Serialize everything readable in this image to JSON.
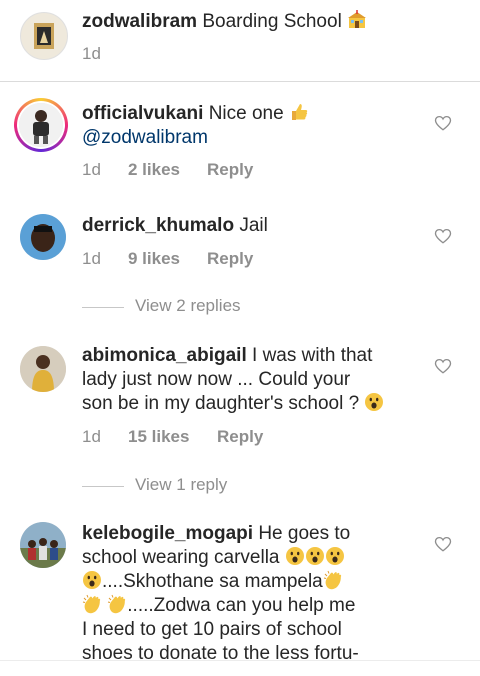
{
  "caption": {
    "username": "zodwalibram",
    "text": "Boarding School",
    "emoji": "school-emoji",
    "time": "1d"
  },
  "comments": [
    {
      "username": "officialvukani",
      "text": "Nice one",
      "emoji": "thumbs-up-emoji",
      "mention": "@zodwalibram",
      "time": "1d",
      "likes": "2 likes",
      "reply": "Reply"
    },
    {
      "username": "derrick_khumalo",
      "text": "Jail",
      "time": "1d",
      "likes": "9 likes",
      "reply": "Reply",
      "view_replies": "View 2 replies"
    },
    {
      "username": "abimonica_abigail",
      "text_line1": "I was with that",
      "text_line2": "lady just now now ... Could your",
      "text_line3": "son be in my daughter's school ?",
      "emoji": "astonished-face-emoji",
      "time": "1d",
      "likes": "15 likes",
      "reply": "Reply",
      "view_replies": "View 1 reply"
    },
    {
      "username": "kelebogile_mogapi",
      "text_line1": "He goes to",
      "text_line2": "school wearing carvella",
      "text_line3": "....Skhothane sa mampela",
      "text_line4": ".....Zodwa  can you help me",
      "text_line5": "I need to get 10 pairs of school",
      "text_line6": "shoes to donate to the less fortu-",
      "emojis": [
        "astonished-face-emoji",
        "clapping-hands-emoji"
      ]
    }
  ],
  "colors": {
    "text": "#262626",
    "meta": "#8e8e8e",
    "mention": "#00376b",
    "divider": "#dbdbdb"
  }
}
